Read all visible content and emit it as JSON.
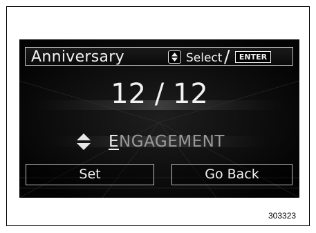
{
  "screen": {
    "title": "Anniversary",
    "hint": {
      "select_label": "Select",
      "separator": "/",
      "enter_label": "ENTER",
      "icon": "up-down-arrows-icon"
    },
    "date_value": "12 / 12",
    "choice": {
      "first_letter": "E",
      "rest": "NGAGEMENT",
      "icon": "up-down-triangles-icon"
    },
    "buttons": {
      "set_label": "Set",
      "back_label": "Go Back"
    }
  },
  "figure_number": "303323"
}
